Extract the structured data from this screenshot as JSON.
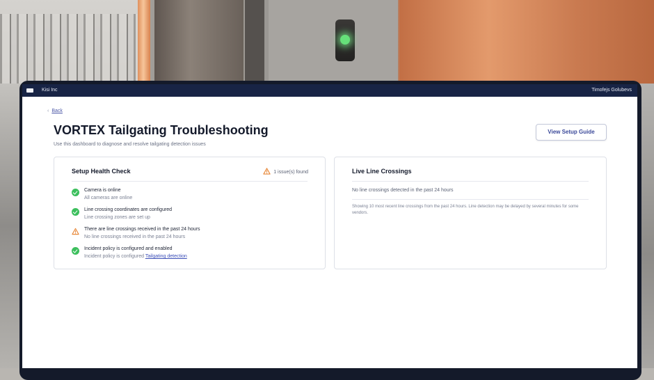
{
  "window": {
    "app_name": "Kisi Inc",
    "user_name": "Timofejs Golubevs"
  },
  "nav": {
    "back_label": "Back"
  },
  "page": {
    "title": "VORTEX Tailgating Troubleshooting",
    "subtitle": "Use this dashboard to diagnose and resolve tailgating detection issues",
    "guide_button": "View Setup Guide"
  },
  "health": {
    "title": "Setup Health Check",
    "issues_count": "1 issue(s) found",
    "items": [
      {
        "status": "ok",
        "icon": "check-circle-icon",
        "label": "Camera is online",
        "detail": "All cameras are online"
      },
      {
        "status": "ok",
        "icon": "check-circle-icon",
        "label": "Line crossing coordinates are configured",
        "detail": "Line crossing zones are set up"
      },
      {
        "status": "warning",
        "icon": "warning-triangle-icon",
        "label": "There are line crossings received in the past 24 hours",
        "detail": "No line crossings received in the past 24 hours"
      },
      {
        "status": "ok",
        "icon": "check-circle-icon",
        "label": "Incident policy is configured and enabled",
        "detail": "Incident policy is configured",
        "link": "Tailgating detection"
      }
    ]
  },
  "live": {
    "title": "Live Line Crossings",
    "empty_message": "No line crossings detected in the past 24 hours",
    "note": "Showing 10 most recent line crossings from the past 24 hours. Line detection may be delayed by several minutes for some vendors."
  },
  "colors": {
    "ok": "#3cbf5d",
    "warning": "#e8893b",
    "accent": "#3c4a9a",
    "titlebar": "#182445"
  }
}
